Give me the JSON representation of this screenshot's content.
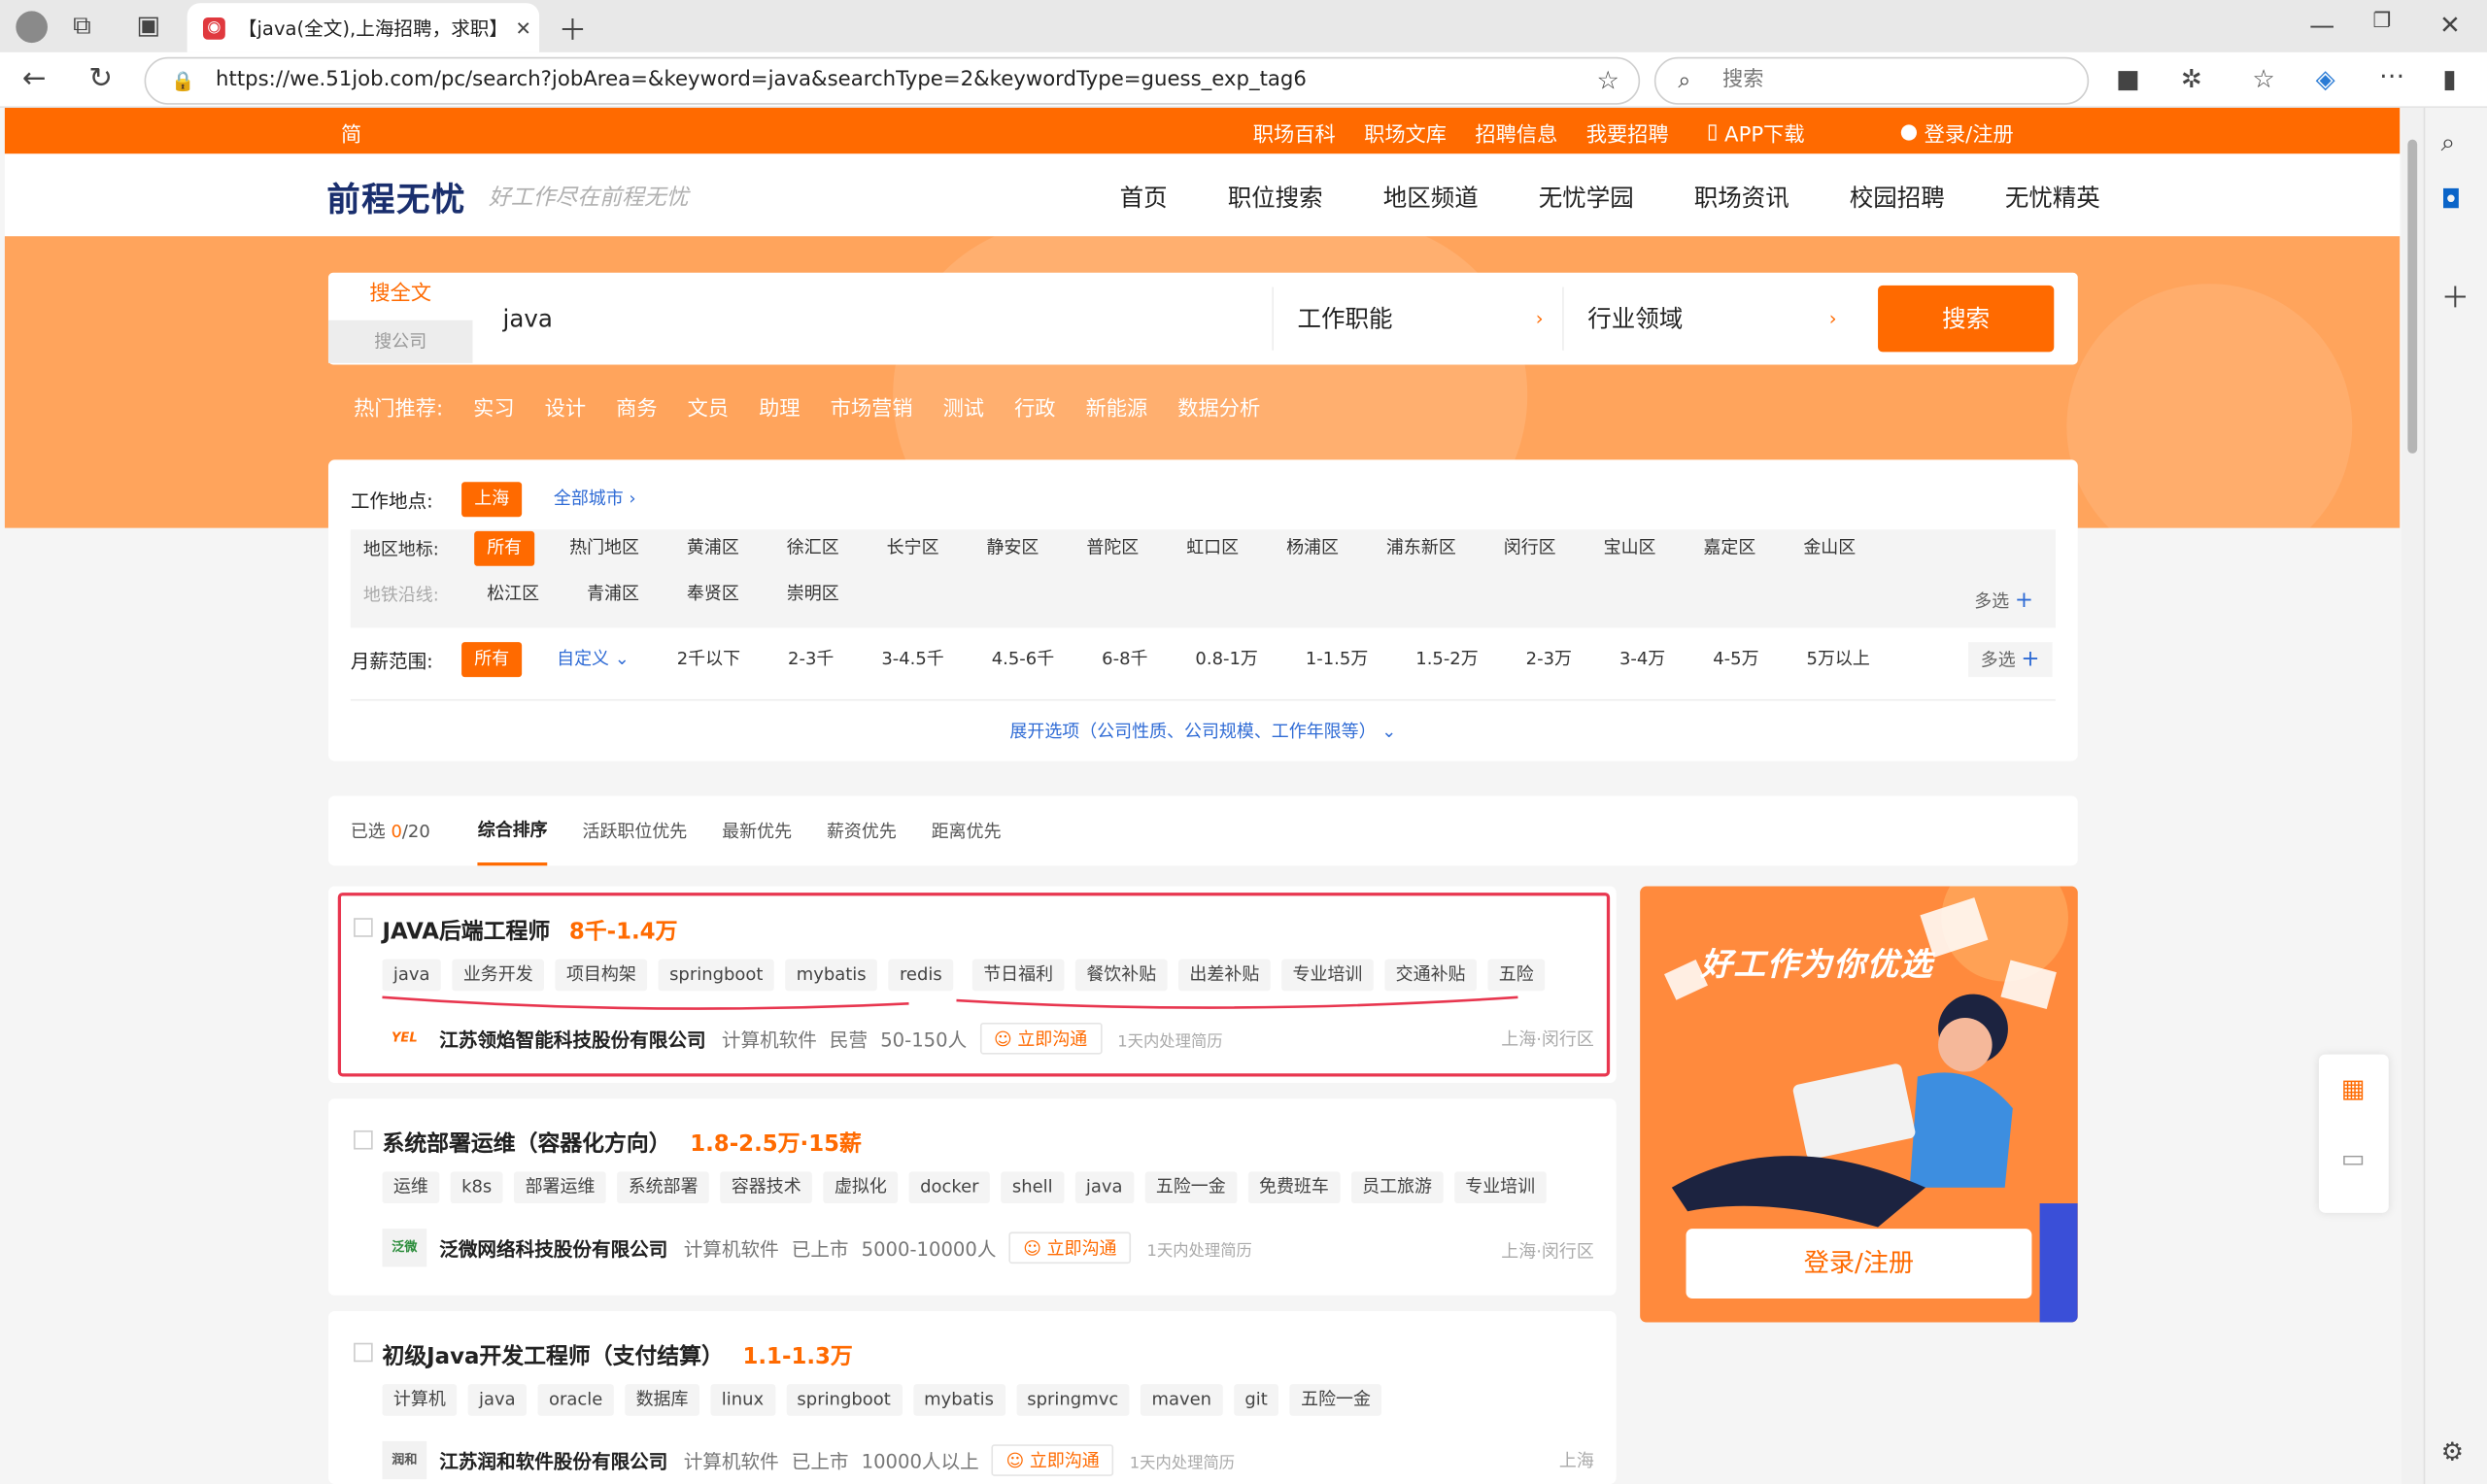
{
  "browser": {
    "tab_title": "【java(全文),上海招聘，求职】-前",
    "url": "https://we.51job.com/pc/search?jobArea=&keyword=java&searchType=2&keywordType=guess_exp_tag6",
    "search_placeholder": "搜索"
  },
  "topnav": {
    "simplified": "简",
    "links": [
      "职场百科",
      "职场文库",
      "招聘信息",
      "我要招聘"
    ],
    "app": "APP下载",
    "login": "登录/注册"
  },
  "header": {
    "logo": "前程无忧",
    "slogan": "好工作尽在前程无忧",
    "nav": [
      "首页",
      "职位搜索",
      "地区频道",
      "无忧学园",
      "职场资讯",
      "校园招聘",
      "无忧精英"
    ]
  },
  "search": {
    "tab_fulltext": "搜全文",
    "tab_company": "搜公司",
    "keyword": "java",
    "function": "工作职能",
    "industry": "行业领域",
    "button": "搜索",
    "hot_label": "热门推荐:",
    "hot": [
      "实习",
      "设计",
      "商务",
      "文员",
      "助理",
      "市场营销",
      "测试",
      "行政",
      "新能源",
      "数据分析"
    ]
  },
  "filter": {
    "location_label": "工作地点:",
    "location_selected": "上海",
    "all_cities": "全部城市",
    "district_label": "地区地标:",
    "districts": [
      "所有",
      "热门地区",
      "黄浦区",
      "徐汇区",
      "长宁区",
      "静安区",
      "普陀区",
      "虹口区",
      "杨浦区",
      "浦东新区",
      "闵行区",
      "宝山区",
      "嘉定区",
      "金山区"
    ],
    "metro_label": "地铁沿线:",
    "districts2": [
      "松江区",
      "青浦区",
      "奉贤区",
      "崇明区"
    ],
    "multi": "多选",
    "salary_label": "月薪范围:",
    "salary_all": "所有",
    "salary_custom": "自定义",
    "salaries": [
      "2千以下",
      "2-3千",
      "3-4.5千",
      "4.5-6千",
      "6-8千",
      "0.8-1万",
      "1-1.5万",
      "1.5-2万",
      "2-3万",
      "3-4万",
      "4-5万",
      "5万以上"
    ],
    "expand": "展开选项（公司性质、公司规模、工作年限等）"
  },
  "sort": {
    "selected_label": "已选",
    "selected_count": "0",
    "selected_total": "/20",
    "options": [
      "综合排序",
      "活跃职位优先",
      "最新优先",
      "薪资优先",
      "距离优先"
    ]
  },
  "jobs": [
    {
      "title": "JAVA后端工程师",
      "salary": "8千-1.4万",
      "tags": [
        "java",
        "业务开发",
        "项目构架",
        "springboot",
        "mybatis",
        "redis",
        "节日福利",
        "餐饮补贴",
        "出差补贴",
        "专业培训",
        "交通补贴",
        "五险"
      ],
      "logo": "YEL",
      "company": "江苏领焰智能科技股份有限公司",
      "industry": "计算机软件",
      "type": "民营",
      "size": "50-150人",
      "chat": "立即沟通",
      "process": "1天内处理简历",
      "location": "上海·闵行区"
    },
    {
      "title": "系统部署运维（容器化方向）",
      "salary": "1.8-2.5万·15薪",
      "tags": [
        "运维",
        "k8s",
        "部署运维",
        "系统部署",
        "容器技术",
        "虚拟化",
        "docker",
        "shell",
        "java",
        "五险一金",
        "免费班车",
        "员工旅游",
        "专业培训"
      ],
      "logo": "泛微",
      "company": "泛微网络科技股份有限公司",
      "industry": "计算机软件",
      "type": "已上市",
      "size": "5000-10000人",
      "chat": "立即沟通",
      "process": "1天内处理简历",
      "location": "上海·闵行区"
    },
    {
      "title": "初级Java开发工程师（支付结算）",
      "salary": "1.1-1.3万",
      "tags": [
        "计算机",
        "java",
        "oracle",
        "数据库",
        "linux",
        "springboot",
        "mybatis",
        "springmvc",
        "maven",
        "git",
        "五险一金"
      ],
      "logo": "润和",
      "company": "江苏润和软件股份有限公司",
      "industry": "计算机软件",
      "type": "已上市",
      "size": "10000人以上",
      "chat": "立即沟通",
      "process": "1天内处理简历",
      "location": "上海"
    }
  ],
  "ad": {
    "headline": "好工作为你优选",
    "button": "登录/注册"
  },
  "colors": {
    "brand": "#ff6a00",
    "highlight": "#e8364f"
  }
}
